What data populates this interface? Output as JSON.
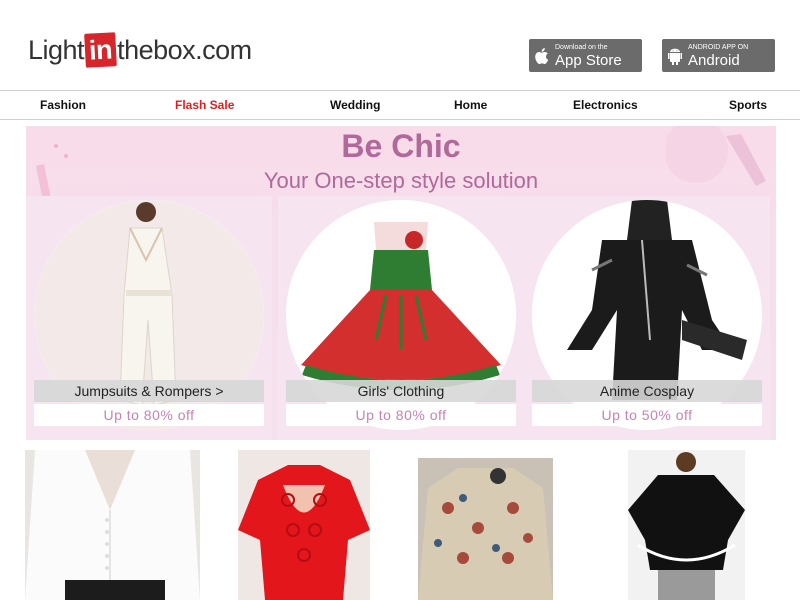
{
  "header": {
    "logo": {
      "pre": "Light",
      "mid": "in",
      "post": "thebox.com"
    },
    "app_store": {
      "small": "Download on the",
      "big": "App Store"
    },
    "android": {
      "small": "ANDROID APP ON",
      "big": "Android"
    }
  },
  "nav": [
    "Fashion",
    "Flash Sale",
    "Wedding",
    "Home",
    "Electronics",
    "Sports"
  ],
  "banner": {
    "title": "Be Chic",
    "subtitle": "Your One-step style solution",
    "cards": [
      {
        "label": "Jumpsuits & Rompers >",
        "offer": "Up to 80% off"
      },
      {
        "label": "Girls' Clothing",
        "offer": "Up to 80% off"
      },
      {
        "label": "Anime Cosplay",
        "offer": "Up to 50% off"
      }
    ]
  },
  "colors": {
    "accent": "#d6262b",
    "flash": "#e11d1d",
    "pink": "#b1689b",
    "offer": "#c882b4"
  },
  "icons": [
    "apple-icon",
    "android-icon"
  ]
}
